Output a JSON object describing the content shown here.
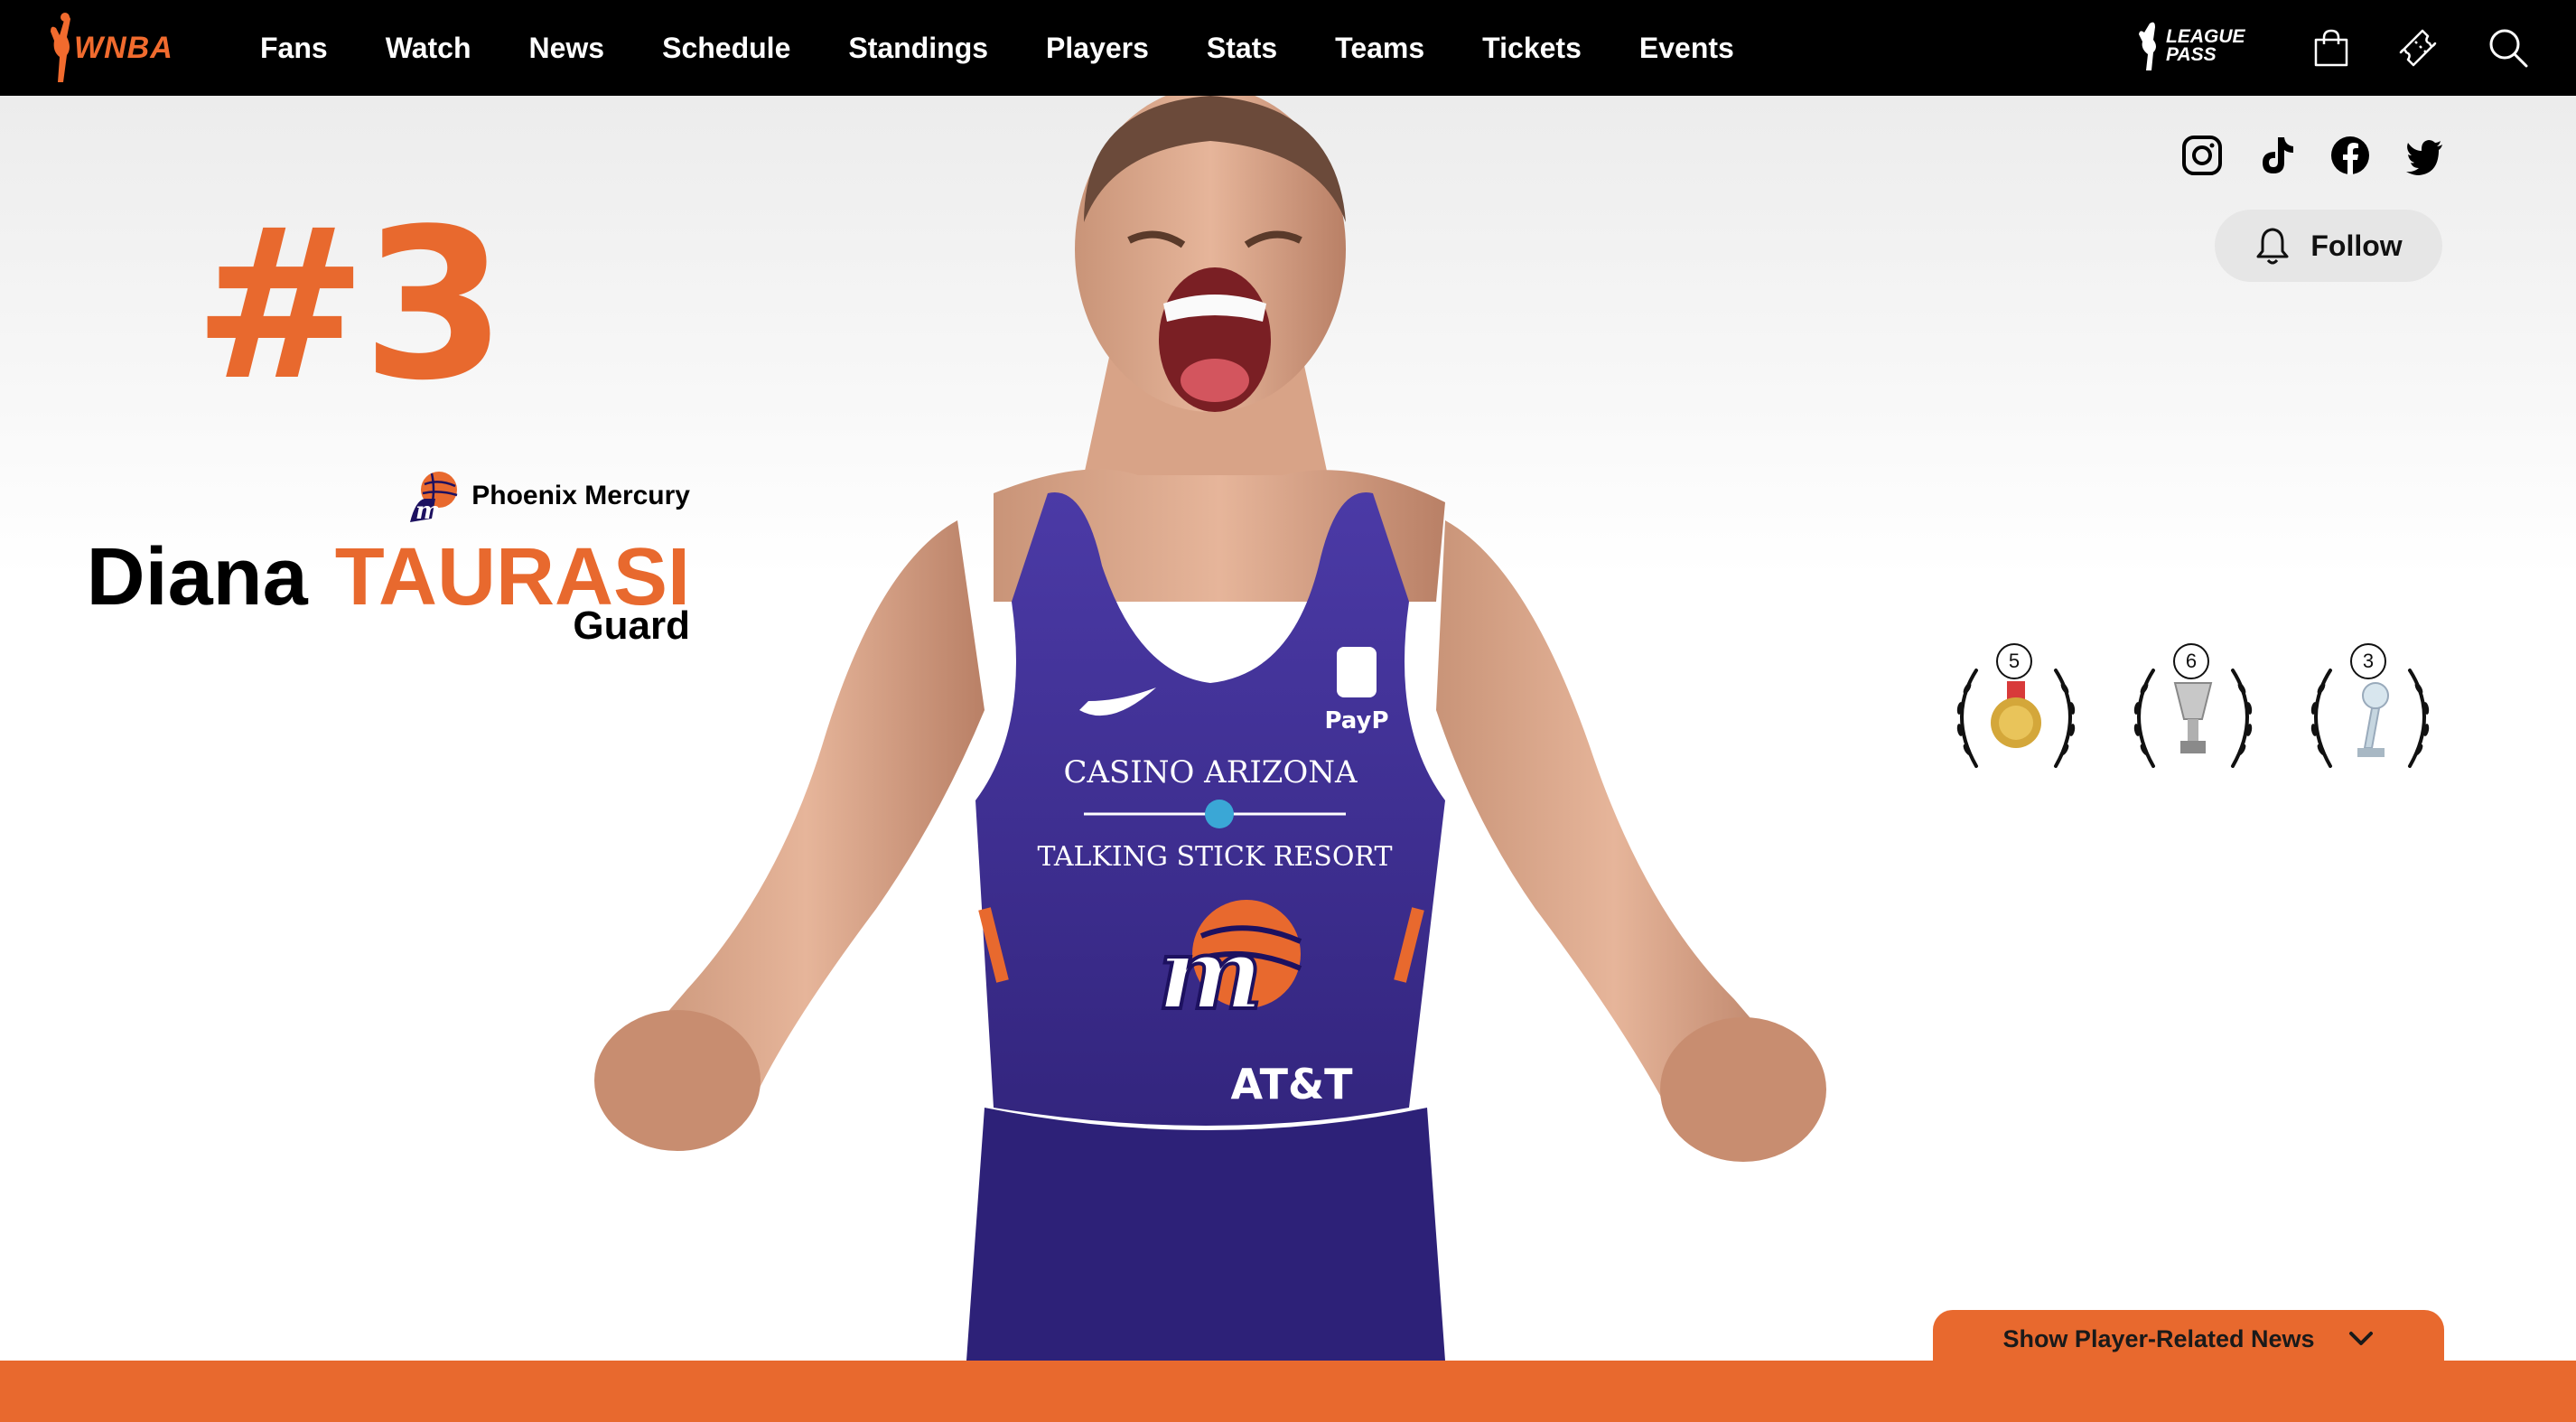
{
  "brand": {
    "logo_text": "WNBA",
    "accent": "#e8692e",
    "nav_bg": "#000000"
  },
  "nav": {
    "items": [
      {
        "label": "Fans"
      },
      {
        "label": "Watch"
      },
      {
        "label": "News"
      },
      {
        "label": "Schedule"
      },
      {
        "label": "Standings"
      },
      {
        "label": "Players"
      },
      {
        "label": "Stats"
      },
      {
        "label": "Teams"
      },
      {
        "label": "Tickets"
      },
      {
        "label": "Events"
      }
    ],
    "league_pass_line1": "LEAGUE",
    "league_pass_line2": "PASS",
    "icons": [
      "shopping-bag-icon",
      "ticket-icon",
      "search-icon"
    ]
  },
  "player": {
    "number": "#3",
    "team": "Phoenix Mercury",
    "first_name": "Diana",
    "last_name": "TAURASI",
    "position": "Guard"
  },
  "social": {
    "icons": [
      "instagram-icon",
      "tiktok-icon",
      "facebook-icon",
      "twitter-icon"
    ]
  },
  "follow": {
    "label": "Follow"
  },
  "awards": [
    {
      "count": "5",
      "icon": "gold-medal-icon"
    },
    {
      "count": "6",
      "icon": "championship-trophy-icon"
    },
    {
      "count": "3",
      "icon": "crystal-trophy-icon"
    }
  ],
  "news": {
    "label": "Show Player-Related News"
  }
}
